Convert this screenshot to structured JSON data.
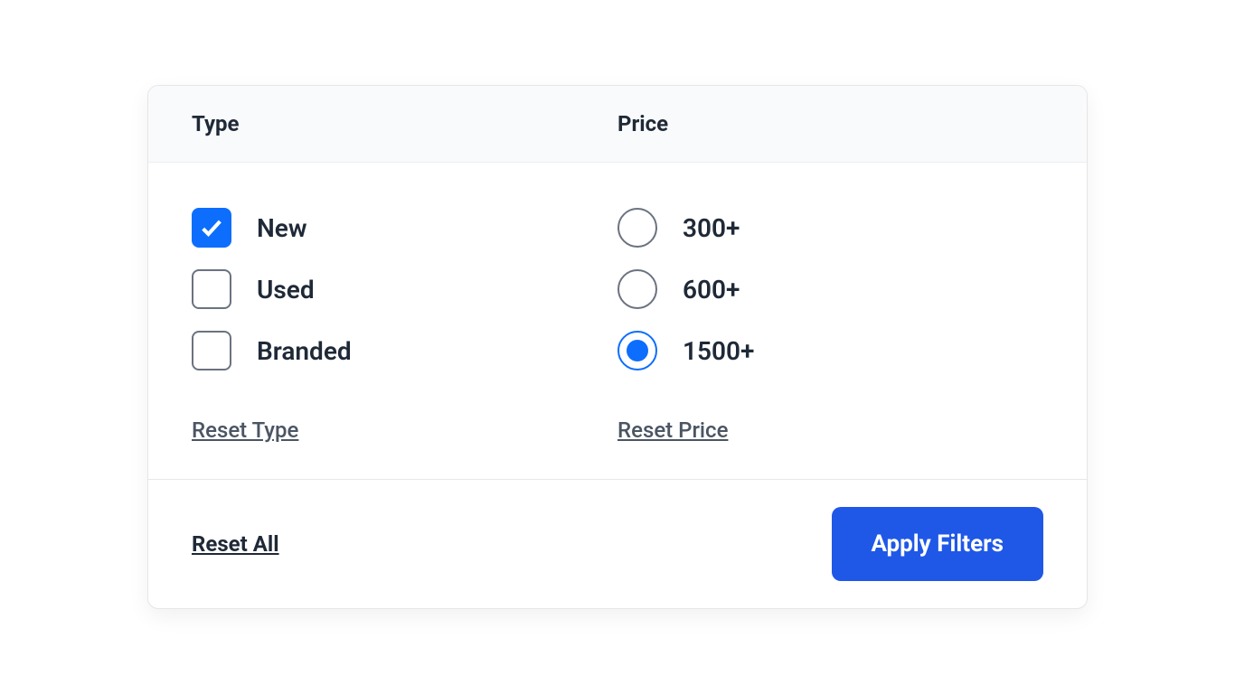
{
  "header": {
    "type_label": "Type",
    "price_label": "Price"
  },
  "type_options": [
    {
      "label": "New",
      "checked": true
    },
    {
      "label": "Used",
      "checked": false
    },
    {
      "label": "Branded",
      "checked": false
    }
  ],
  "price_options": [
    {
      "label": "300+",
      "selected": false
    },
    {
      "label": "600+",
      "selected": false
    },
    {
      "label": "1500+",
      "selected": true
    }
  ],
  "reset_type_label": "Reset Type",
  "reset_price_label": "Reset Price",
  "footer": {
    "reset_all_label": "Reset All",
    "apply_label": "Apply Filters"
  }
}
